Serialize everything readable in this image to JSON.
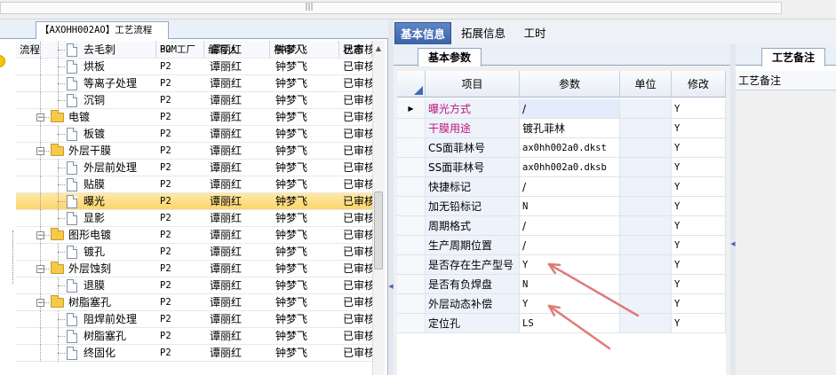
{
  "top_scroll_grip": "|||",
  "left_panel": {
    "tab_label": "【AXOHH002AO】工艺流程",
    "columns": [
      "流程",
      "BOM工厂",
      "编写人",
      "核审人",
      "状态"
    ],
    "rows": [
      {
        "name": "去毛刺",
        "type": "doc",
        "bom": "P2",
        "writer": "谭丽红",
        "reviewer": "钟梦飞",
        "status": "已审核"
      },
      {
        "name": "烘板",
        "type": "doc",
        "bom": "P2",
        "writer": "谭丽红",
        "reviewer": "钟梦飞",
        "status": "已审核"
      },
      {
        "name": "等离子处理",
        "type": "doc",
        "bom": "P2",
        "writer": "谭丽红",
        "reviewer": "钟梦飞",
        "status": "已审核"
      },
      {
        "name": "沉铜",
        "type": "doc",
        "bom": "P2",
        "writer": "谭丽红",
        "reviewer": "钟梦飞",
        "status": "已审核"
      },
      {
        "name": "电镀",
        "type": "folder",
        "bom": "P2",
        "writer": "谭丽红",
        "reviewer": "钟梦飞",
        "status": "已审核"
      },
      {
        "name": "板镀",
        "type": "doc",
        "bom": "P2",
        "writer": "谭丽红",
        "reviewer": "钟梦飞",
        "status": "已审核"
      },
      {
        "name": "外层干膜",
        "type": "folder",
        "bom": "P2",
        "writer": "谭丽红",
        "reviewer": "钟梦飞",
        "status": "已审核"
      },
      {
        "name": "外层前处理",
        "type": "doc",
        "bom": "P2",
        "writer": "谭丽红",
        "reviewer": "钟梦飞",
        "status": "已审核"
      },
      {
        "name": "贴膜",
        "type": "doc",
        "bom": "P2",
        "writer": "谭丽红",
        "reviewer": "钟梦飞",
        "status": "已审核"
      },
      {
        "name": "曝光",
        "type": "doc",
        "bom": "P2",
        "writer": "谭丽红",
        "reviewer": "钟梦飞",
        "status": "已审核",
        "selected": true
      },
      {
        "name": "显影",
        "type": "doc",
        "bom": "P2",
        "writer": "谭丽红",
        "reviewer": "钟梦飞",
        "status": "已审核"
      },
      {
        "name": "图形电镀",
        "type": "folder",
        "bom": "P2",
        "writer": "谭丽红",
        "reviewer": "钟梦飞",
        "status": "已审核"
      },
      {
        "name": "镀孔",
        "type": "doc",
        "bom": "P2",
        "writer": "谭丽红",
        "reviewer": "钟梦飞",
        "status": "已审核"
      },
      {
        "name": "外层蚀刻",
        "type": "folder",
        "bom": "P2",
        "writer": "谭丽红",
        "reviewer": "钟梦飞",
        "status": "已审核"
      },
      {
        "name": "退膜",
        "type": "doc",
        "bom": "P2",
        "writer": "谭丽红",
        "reviewer": "钟梦飞",
        "status": "已审核"
      },
      {
        "name": "树脂塞孔",
        "type": "folder",
        "bom": "P2",
        "writer": "谭丽红",
        "reviewer": "钟梦飞",
        "status": "已审核"
      },
      {
        "name": "阻焊前处理",
        "type": "doc",
        "bom": "P2",
        "writer": "谭丽红",
        "reviewer": "钟梦飞",
        "status": "已审核"
      },
      {
        "name": "树脂塞孔",
        "type": "doc",
        "bom": "P2",
        "writer": "谭丽红",
        "reviewer": "钟梦飞",
        "status": "已审核"
      },
      {
        "name": "终固化",
        "type": "doc",
        "bom": "P2",
        "writer": "谭丽红",
        "reviewer": "钟梦飞",
        "status": "已审核"
      }
    ]
  },
  "main_tabs": [
    "基本信息",
    "拓展信息",
    "工时"
  ],
  "sub_tab": "基本参数",
  "grid": {
    "columns": [
      "项目",
      "参数",
      "单位",
      "修改"
    ],
    "rows": [
      {
        "item": "曝光方式",
        "param": "/",
        "unit": "",
        "mod": "Y",
        "current": true,
        "pink": true
      },
      {
        "item": "干膜用途",
        "param": "镀孔菲林",
        "unit": "",
        "mod": "Y",
        "pink": true
      },
      {
        "item": "CS面菲林号",
        "param": "ax0hh002a0.dkst",
        "unit": "",
        "mod": "Y",
        "mono": true
      },
      {
        "item": "SS面菲林号",
        "param": "ax0hh002a0.dksb",
        "unit": "",
        "mod": "Y",
        "mono": true
      },
      {
        "item": "快捷标记",
        "param": "/",
        "unit": "",
        "mod": "Y"
      },
      {
        "item": "加无铅标记",
        "param": "N",
        "unit": "",
        "mod": "Y",
        "mono": true
      },
      {
        "item": "周期格式",
        "param": "/",
        "unit": "",
        "mod": "Y"
      },
      {
        "item": "生产周期位置",
        "param": "/",
        "unit": "",
        "mod": "Y"
      },
      {
        "item": "是否存在生产型号",
        "param": "Y",
        "unit": "",
        "mod": "Y",
        "mono": true
      },
      {
        "item": "是否有负焊盘",
        "param": "N",
        "unit": "",
        "mod": "Y",
        "mono": true
      },
      {
        "item": "外层动态补偿",
        "param": "Y",
        "unit": "",
        "mod": "Y",
        "mono": true
      },
      {
        "item": "定位孔",
        "param": "LS",
        "unit": "",
        "mod": "Y",
        "mono": true
      }
    ]
  },
  "right_panel": {
    "tab_label": "工艺备注",
    "header": "工艺备注"
  },
  "colors": {
    "accent": "#3b62a8",
    "selection": "#fbd56a",
    "annotation_arrow": "#e07a7a",
    "pink_text": "#c0127a"
  }
}
